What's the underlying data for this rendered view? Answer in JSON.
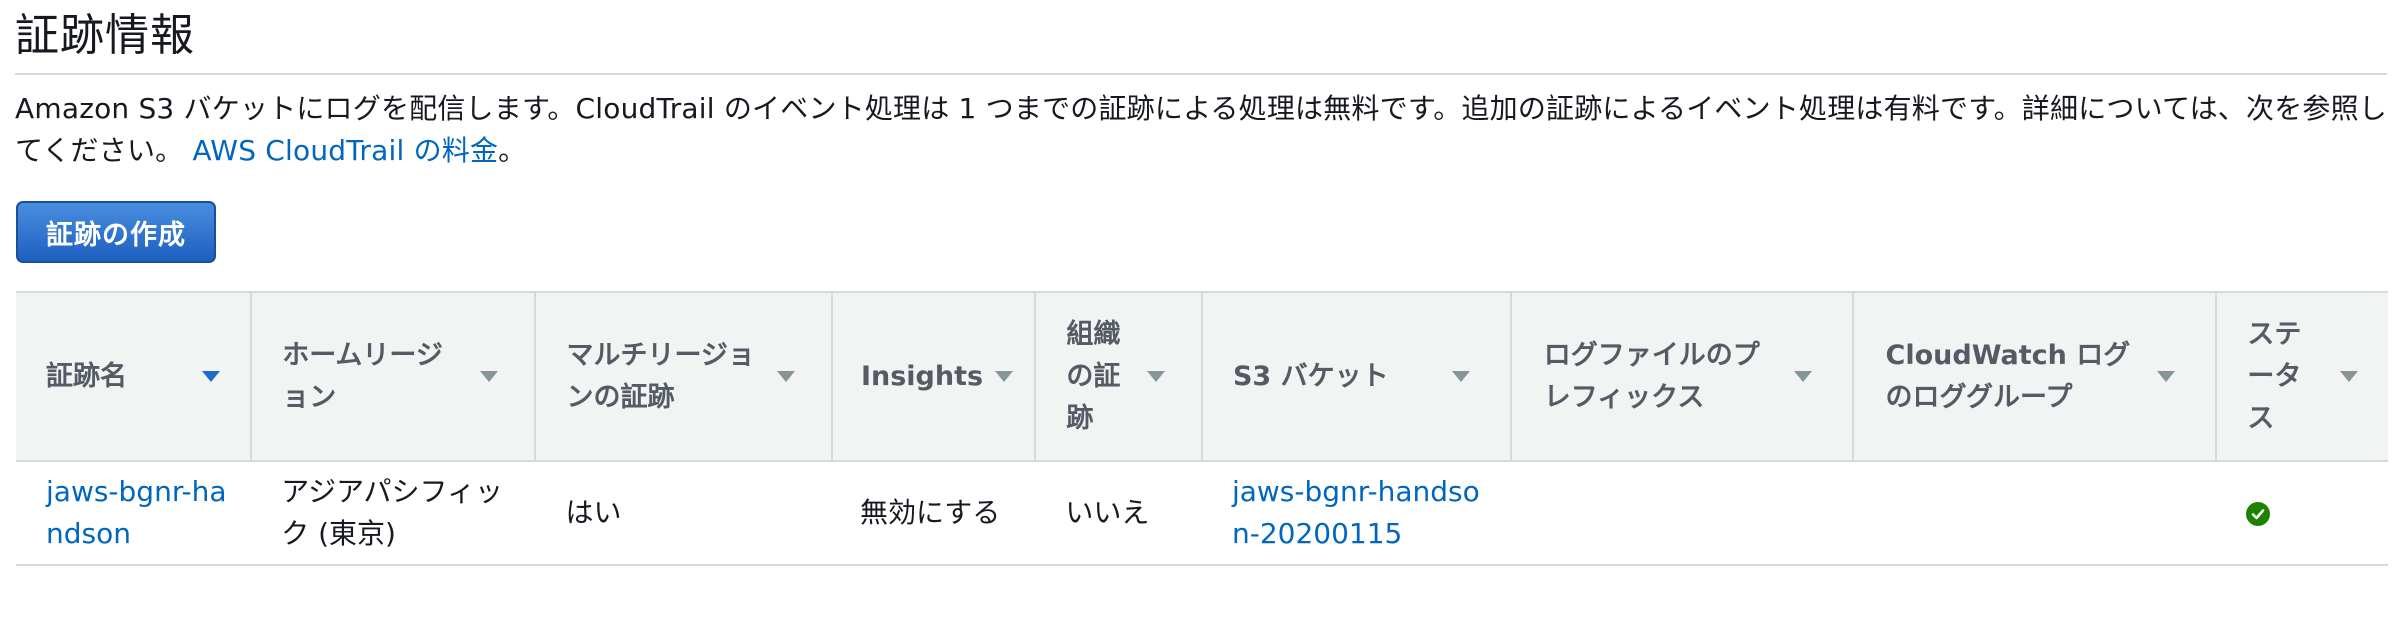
{
  "page": {
    "title": "証跡情報",
    "description": "Amazon S3 バケットにログを配信します。CloudTrail のイベント処理は 1 つまでの証跡による処理は無料です。追加の証跡によるイベント処理は有料です。詳細については、次を参照してください。",
    "pricing_link": "AWS CloudTrail の料金",
    "description_end": "。",
    "create_button": "証跡の作成"
  },
  "table": {
    "columns": [
      {
        "label": "証跡名",
        "sort": "active"
      },
      {
        "label": "ホームリージョン",
        "sort": "inactive"
      },
      {
        "label": "マルチリージョンの証跡",
        "sort": "inactive"
      },
      {
        "label": "Insights",
        "sort": "inactive"
      },
      {
        "label": "組織の証跡",
        "sort": "inactive"
      },
      {
        "label": "S3 バケット",
        "sort": "inactive"
      },
      {
        "label": "ログファイルのプレフィックス",
        "sort": "inactive"
      },
      {
        "label": "CloudWatch ログのロググループ",
        "sort": "inactive"
      },
      {
        "label": "ステータス",
        "sort": "inactive"
      }
    ],
    "rows": [
      {
        "trail_name": "jaws-bgnr-handson",
        "home_region": "アジアパシフィック (東京)",
        "multi_region": "はい",
        "insights": "無効にする",
        "organization": "いいえ",
        "s3_bucket": "jaws-bgnr-handson-20200115",
        "log_prefix": "",
        "cloudwatch_log_group": "",
        "status_icon": "check-circle-icon",
        "status_color": "#1d8102"
      }
    ]
  },
  "colors": {
    "link": "#0066c0",
    "button": "#1f6cc6",
    "header_bg": "#f2f3f3"
  }
}
